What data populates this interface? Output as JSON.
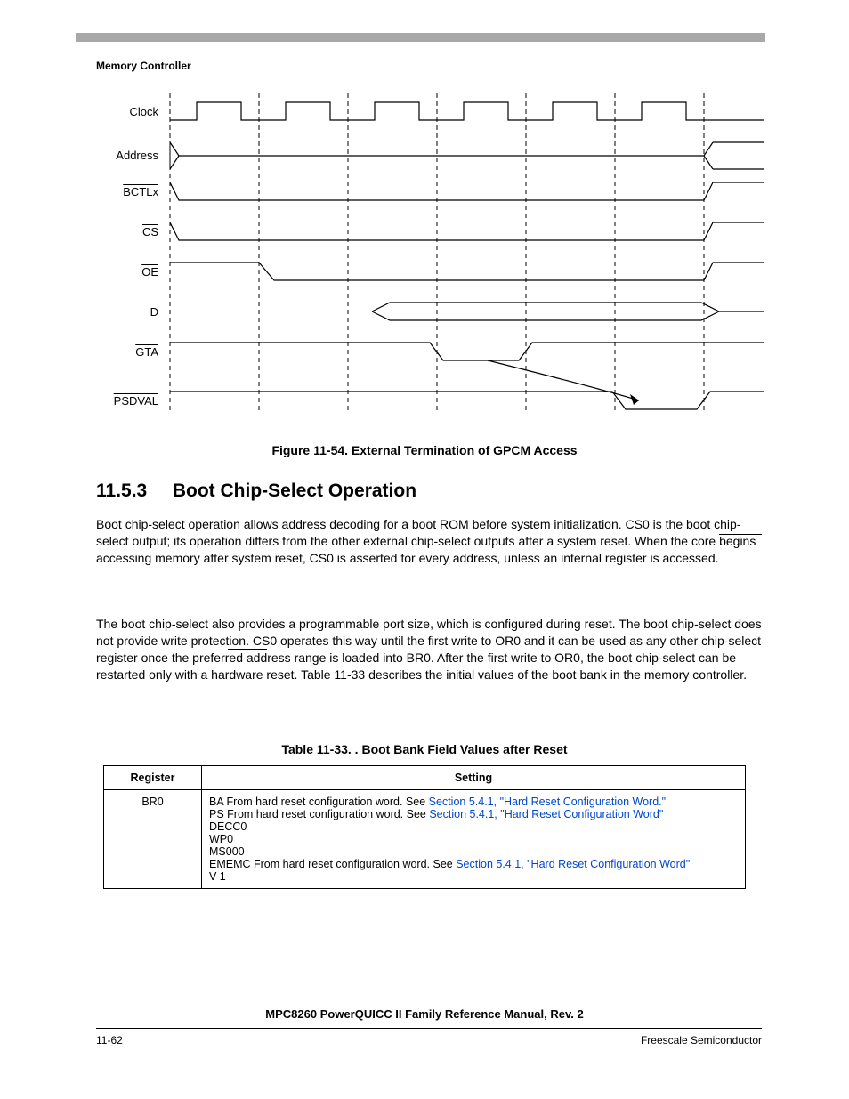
{
  "header": "Memory Controller",
  "signals": [
    "Clock",
    "Address",
    "BCTLx",
    "CS",
    "OE",
    "D",
    "GTA",
    "PSDVAL"
  ],
  "signal_overline": [
    false,
    false,
    true,
    true,
    true,
    false,
    true,
    true
  ],
  "figure_caption": "Figure 11-54. External Termination of GPCM Access",
  "section": {
    "num": "11.5.3",
    "title": "Boot Chip-Select Operation"
  },
  "para1": "Boot chip-select operation allows address decoding for a boot ROM before system initialization. CS0 is the boot chip-select output; its operation differs from the other external chip-select outputs after a system reset. When the core begins accessing memory after system reset, CS0 is asserted for every address, unless an internal register is accessed.",
  "para2": "The boot chip-select also provides a programmable port size, which is configured during reset. The boot chip-select does not provide write protection. CS0 operates this way until the first write to OR0 and it can be used as any other chip-select register once the preferred address range is loaded into BR0. After the first write to OR0, the boot chip-select can be restarted only with a hardware reset. Table 11-33 describes the initial values of the boot bank in the memory controller.",
  "table_caption": "Table 11-33. . Boot Bank Field Values after Reset",
  "table": {
    "headers": [
      "Register",
      "Setting"
    ],
    "row_reg": "BR0",
    "setting_lines": {
      "l1_pre": "BA From hard reset configuration word. See ",
      "l1_link": "Section 5.4.1, \"Hard Reset Configuration Word.\"",
      "l2_pre": "PS From hard reset configuration word. See ",
      "l2_link": "Section 5.4.1, \"Hard Reset Configuration Word\"",
      "l3": "DECC0",
      "l4": "WP0",
      "l5": "MS000",
      "l6_pre": "EMEMC From hard reset configuration word. See ",
      "l6_link": "Section 5.4.1, \"Hard Reset Configuration Word\"",
      "l7": "V  1"
    }
  },
  "footer_title": "MPC8260 PowerQUICC II Family Reference Manual, Rev. 2",
  "page_num": "11-62",
  "footer_right": "Freescale Semiconductor"
}
